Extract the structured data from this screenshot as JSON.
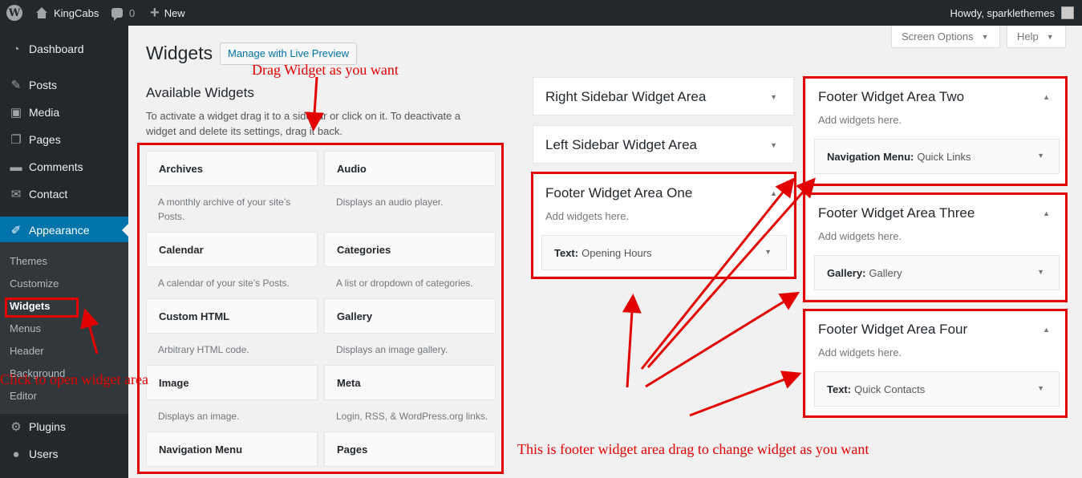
{
  "admin_bar": {
    "site_name": "KingCabs",
    "comments_count": "0",
    "new_label": "New",
    "greeting": "Howdy, sparklethemes"
  },
  "sidebar_menu": {
    "dashboard": "Dashboard",
    "posts": "Posts",
    "media": "Media",
    "pages": "Pages",
    "comments": "Comments",
    "contact": "Contact",
    "appearance": "Appearance",
    "submenu": [
      "Themes",
      "Customize",
      "Widgets",
      "Menus",
      "Header",
      "Background",
      "Editor"
    ],
    "plugins": "Plugins",
    "users": "Users"
  },
  "header": {
    "title": "Widgets",
    "live_preview": "Manage with Live Preview",
    "screen_options": "Screen Options",
    "help": "Help"
  },
  "available": {
    "title": "Available Widgets",
    "description": "To activate a widget drag it to a sidebar or click on it. To deactivate a widget and delete its settings, drag it back.",
    "widgets": [
      {
        "name": "Archives",
        "desc": "A monthly archive of your site’s Posts."
      },
      {
        "name": "Audio",
        "desc": "Displays an audio player."
      },
      {
        "name": "Calendar",
        "desc": "A calendar of your site’s Posts."
      },
      {
        "name": "Categories",
        "desc": "A list or dropdown of categories."
      },
      {
        "name": "Custom HTML",
        "desc": "Arbitrary HTML code."
      },
      {
        "name": "Gallery",
        "desc": "Displays an image gallery."
      },
      {
        "name": "Image",
        "desc": "Displays an image."
      },
      {
        "name": "Meta",
        "desc": "Login, RSS, & WordPress.org links."
      },
      {
        "name": "Navigation Menu",
        "desc": ""
      },
      {
        "name": "Pages",
        "desc": ""
      }
    ]
  },
  "sidebars": {
    "right": {
      "title": "Right Sidebar Widget Area"
    },
    "left": {
      "title": "Left Sidebar Widget Area"
    },
    "footer_one": {
      "title": "Footer Widget Area One",
      "hint": "Add widgets here.",
      "widget_name": "Text:",
      "widget_title": "Opening Hours"
    },
    "footer_two": {
      "title": "Footer Widget Area Two",
      "hint": "Add widgets here.",
      "widget_name": "Navigation Menu:",
      "widget_title": "Quick Links"
    },
    "footer_three": {
      "title": "Footer Widget Area Three",
      "hint": "Add widgets here.",
      "widget_name": "Gallery:",
      "widget_title": "Gallery"
    },
    "footer_four": {
      "title": "Footer Widget Area Four",
      "hint": "Add widgets here.",
      "widget_name": "Text:",
      "widget_title": "Quick Contacts"
    }
  },
  "annotations": {
    "drag": "Drag Widget as you want",
    "click": "Click to open widget area",
    "footer": "This is footer widget area drag to change widget as you want"
  },
  "colors": {
    "admin_bar": "#23282d",
    "accent": "#0073aa",
    "annotation": "#e30000"
  }
}
